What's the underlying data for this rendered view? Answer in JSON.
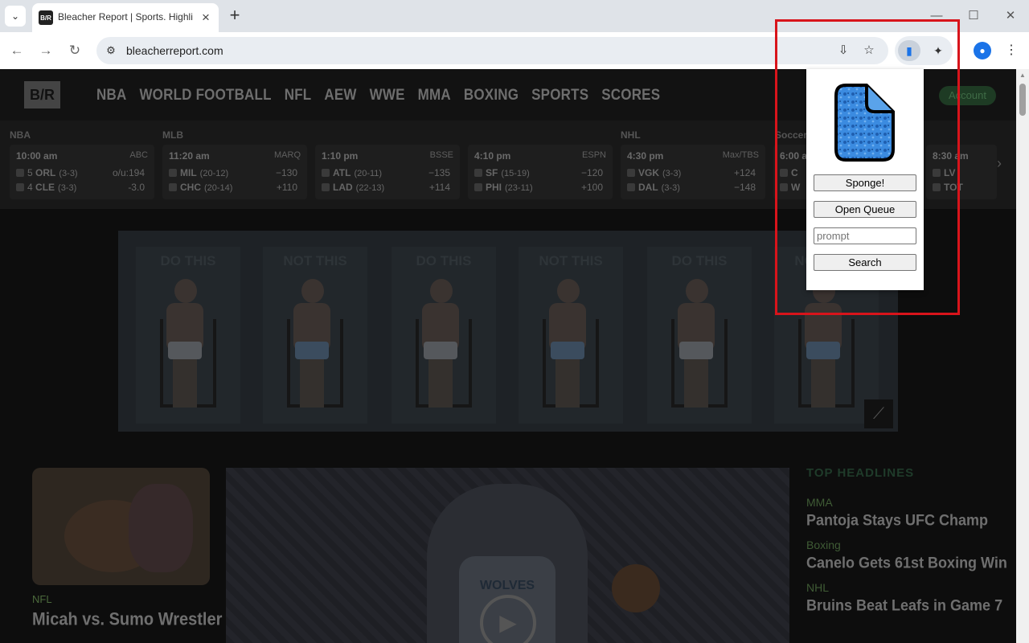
{
  "browser": {
    "tab_title": "Bleacher Report | Sports. Highli",
    "url": "bleacherreport.com"
  },
  "site": {
    "logo": "B/R",
    "nav": [
      "NBA",
      "WORLD FOOTBALL",
      "NFL",
      "AEW",
      "WWE",
      "MMA",
      "BOXING",
      "SPORTS",
      "SCORES"
    ],
    "account": "Account"
  },
  "scores": {
    "leagues": [
      "NBA",
      "MLB",
      "NHL",
      "Soccer"
    ],
    "games": [
      {
        "time": "10:00 am",
        "network": "ABC",
        "team1": {
          "seed": "5",
          "abbr": "ORL",
          "record": "(3-3)",
          "odds": "o/u:194"
        },
        "team2": {
          "seed": "4",
          "abbr": "CLE",
          "record": "(3-3)",
          "odds": "-3.0"
        }
      },
      {
        "time": "11:20 am",
        "network": "MARQ",
        "team1": {
          "seed": "",
          "abbr": "MIL",
          "record": "(20-12)",
          "odds": "−130"
        },
        "team2": {
          "seed": "",
          "abbr": "CHC",
          "record": "(20-14)",
          "odds": "+110"
        }
      },
      {
        "time": "1:10 pm",
        "network": "BSSE",
        "team1": {
          "seed": "",
          "abbr": "ATL",
          "record": "(20-11)",
          "odds": "−135"
        },
        "team2": {
          "seed": "",
          "abbr": "LAD",
          "record": "(22-13)",
          "odds": "+114"
        }
      },
      {
        "time": "4:10 pm",
        "network": "ESPN",
        "team1": {
          "seed": "",
          "abbr": "SF",
          "record": "(15-19)",
          "odds": "−120"
        },
        "team2": {
          "seed": "",
          "abbr": "PHI",
          "record": "(23-11)",
          "odds": "+100"
        }
      },
      {
        "time": "4:30 pm",
        "network": "Max/TBS",
        "team1": {
          "seed": "",
          "abbr": "VGK",
          "record": "(3-3)",
          "odds": "+124"
        },
        "team2": {
          "seed": "",
          "abbr": "DAL",
          "record": "(3-3)",
          "odds": "−148"
        }
      },
      {
        "time": "6:00 a",
        "network": "",
        "team1": {
          "seed": "",
          "abbr": "C",
          "record": "",
          "odds": ""
        },
        "team2": {
          "seed": "",
          "abbr": "W",
          "record": "",
          "odds": ""
        }
      },
      {
        "time": "8:30 am",
        "network": "",
        "team1": {
          "seed": "",
          "abbr": "LV",
          "record": "",
          "odds": ""
        },
        "team2": {
          "seed": "",
          "abbr": "TOT",
          "record": "",
          "odds": ""
        }
      }
    ]
  },
  "ad": {
    "captions": [
      "DO THIS",
      "NOT THIS",
      "DO THIS",
      "NOT THIS",
      "DO THIS",
      "NOT THIS"
    ]
  },
  "story_card": {
    "tag": "NFL",
    "title": "Micah vs. Sumo Wrestler"
  },
  "hero": {
    "jersey_text": "WOLVES"
  },
  "headlines": {
    "title": "TOP HEADLINES",
    "items": [
      {
        "category": "MMA",
        "title": "Pantoja Stays UFC Champ"
      },
      {
        "category": "Boxing",
        "title": "Canelo Gets 61st Boxing Win"
      },
      {
        "category": "NHL",
        "title": "Bruins Beat Leafs in Game 7"
      }
    ]
  },
  "popup": {
    "sponge_label": "Sponge!",
    "queue_label": "Open Queue",
    "prompt_placeholder": "prompt",
    "search_label": "Search"
  },
  "colors": {
    "highlight": "#d8141b",
    "accent": "#1a73e8"
  }
}
